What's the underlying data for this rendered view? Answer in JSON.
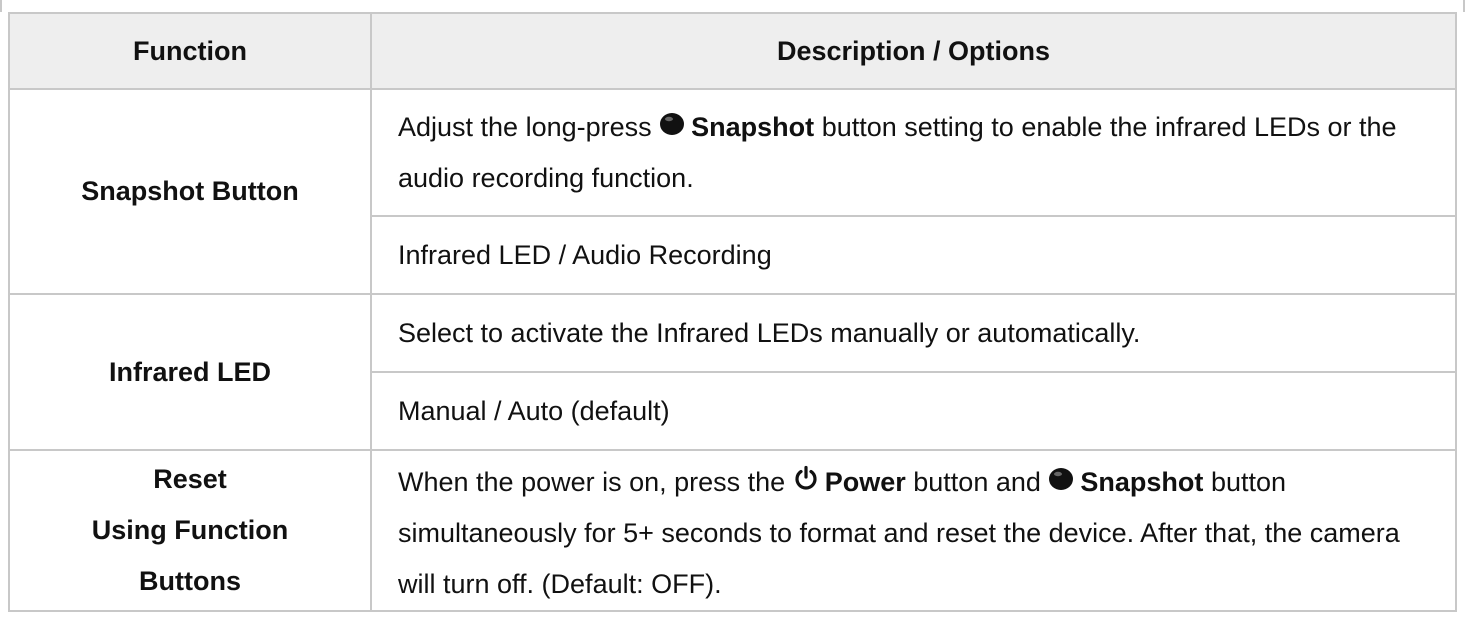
{
  "table": {
    "header": {
      "function": "Function",
      "description": "Description / Options"
    },
    "rows": [
      {
        "function": "Snapshot Button",
        "description": {
          "pre": "Adjust the long-press",
          "icon": "snapshot-dot-icon",
          "bold": "Snapshot",
          "post": "button setting to enable the infrared LEDs or the audio recording function."
        },
        "options": "Infrared LED / Audio Recording"
      },
      {
        "function": "Infrared LED",
        "description": "Select to activate the Infrared LEDs manually or automatically.",
        "options": "Manual / Auto (default)"
      },
      {
        "function_lines": [
          "Reset",
          "Using Function",
          "Buttons"
        ],
        "description": {
          "pre": "When the power is on, press the",
          "icon1": "power-icon",
          "bold1": "Power",
          "mid": "button and",
          "icon2": "snapshot-dot-icon",
          "bold2": "Snapshot",
          "post": "button simultaneously for 5+ seconds to format and reset the device. After that, the camera will turn off. (Default: OFF)."
        }
      }
    ]
  }
}
